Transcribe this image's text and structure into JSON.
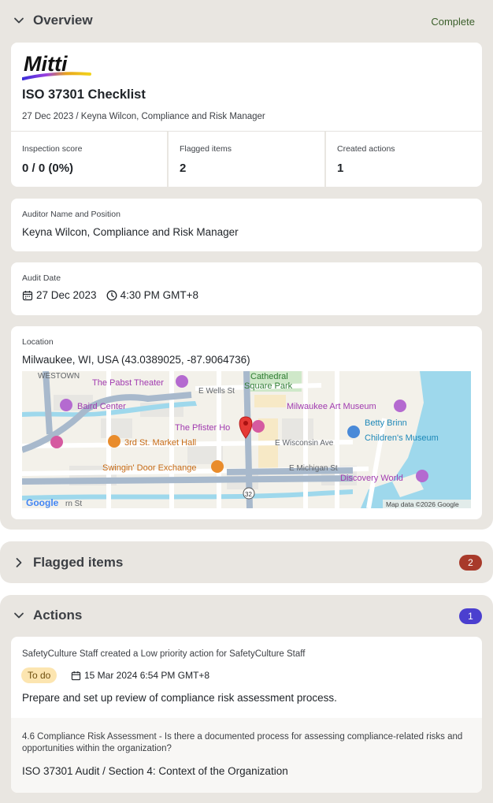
{
  "overview": {
    "title": "Overview",
    "status": "Complete",
    "brand": "Mitti",
    "checklist_title": "ISO 37301 Checklist",
    "meta": "27 Dec 2023 / Keyna Wilcon, Compliance and Risk Manager",
    "stats": [
      {
        "label": "Inspection score",
        "value": "0 / 0 (0%)"
      },
      {
        "label": "Flagged items",
        "value": "2"
      },
      {
        "label": "Created actions",
        "value": "1"
      }
    ],
    "auditor": {
      "label": "Auditor Name and Position",
      "value": "Keyna Wilcon, Compliance and Risk Manager"
    },
    "audit_date": {
      "label": "Audit Date",
      "date": "27 Dec 2023",
      "time": "4:30 PM GMT+8"
    },
    "location": {
      "label": "Location",
      "value": "Milwaukee, WI, USA (43.0389025, -87.9064736)",
      "map": {
        "places": {
          "westown": "WESTOWN",
          "pabst": "The Pabst Theater",
          "cathedral1": "Cathedral",
          "cathedral2": "Square Park",
          "wells": "E Wells St",
          "baird": "Baird Center",
          "art_museum": "Milwaukee Art Museum",
          "betty1": "Betty Brinn",
          "betty2": "Children's Museum",
          "pfister": "The Pfister Ho",
          "market": "3rd St. Market Hall",
          "wisconsin": "E Wisconsin Ave",
          "swingin": "Swingin' Door Exchange",
          "michigan": "E Michigan St",
          "discovery": "Discovery World",
          "route": "32",
          "google": "Google",
          "mst": "rn St",
          "attribution": "Map data ©2026 Google"
        }
      }
    }
  },
  "flagged": {
    "title": "Flagged items",
    "count": "2",
    "badge_color": "#a83a2a"
  },
  "actions": {
    "title": "Actions",
    "count": "1",
    "badge_color": "#4b3fcf",
    "item": {
      "created_by": "SafetyCulture Staff created a Low priority action for SafetyCulture Staff",
      "status": "To do",
      "due": "15 Mar 2024 6:54 PM GMT+8",
      "description": "Prepare and set up review of compliance risk assessment process.",
      "question": "4.6 Compliance Risk Assessment - Is there a documented process for assessing compliance-related risks and opportunities within the organization?",
      "path": "ISO 37301 Audit / Section 4: Context of the Organization"
    }
  }
}
